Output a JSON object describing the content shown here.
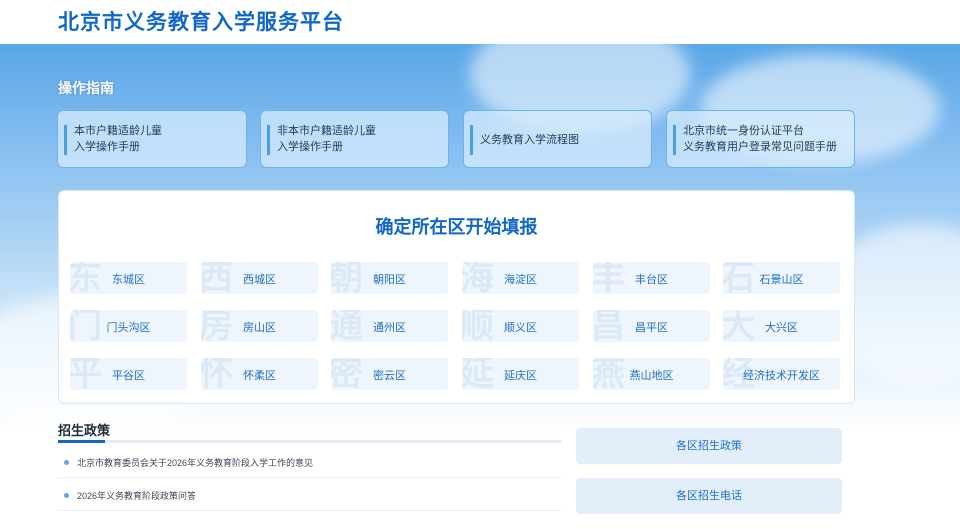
{
  "header": {
    "title": "北京市义务教育入学服务平台"
  },
  "guide": {
    "title": "操作指南",
    "cards": [
      {
        "line1": "本市户籍适龄儿童",
        "line2": "入学操作手册"
      },
      {
        "line1": "非本市户籍适龄儿童",
        "line2": "入学操作手册"
      },
      {
        "line1": "义务教育入学流程图",
        "line2": ""
      },
      {
        "line1": "北京市统一身份认证平台",
        "line2": "义务教育用户登录常见问题手册"
      }
    ]
  },
  "districts": {
    "title": "确定所在区开始填报",
    "items": [
      {
        "bg": "东",
        "name": "东城区"
      },
      {
        "bg": "西",
        "name": "西城区"
      },
      {
        "bg": "朝",
        "name": "朝阳区"
      },
      {
        "bg": "海",
        "name": "海淀区"
      },
      {
        "bg": "丰",
        "name": "丰台区"
      },
      {
        "bg": "石",
        "name": "石景山区"
      },
      {
        "bg": "门",
        "name": "门头沟区"
      },
      {
        "bg": "房",
        "name": "房山区"
      },
      {
        "bg": "通",
        "name": "通州区"
      },
      {
        "bg": "顺",
        "name": "顺义区"
      },
      {
        "bg": "昌",
        "name": "昌平区"
      },
      {
        "bg": "大",
        "name": "大兴区"
      },
      {
        "bg": "平",
        "name": "平谷区"
      },
      {
        "bg": "怀",
        "name": "怀柔区"
      },
      {
        "bg": "密",
        "name": "密云区"
      },
      {
        "bg": "延",
        "name": "延庆区"
      },
      {
        "bg": "燕",
        "name": "燕山地区"
      },
      {
        "bg": "经",
        "name": "经济技术开发区"
      }
    ]
  },
  "policy": {
    "heading": "招生政策",
    "news": [
      "北京市教育委员会关于2026年义务教育阶段入学工作的意见",
      "2026年义务教育阶段政策问答"
    ],
    "side_buttons": [
      "各区招生政策",
      "各区招生电话"
    ]
  },
  "colors": {
    "brand": "#1167c7",
    "accent": "#4a9ee6"
  }
}
